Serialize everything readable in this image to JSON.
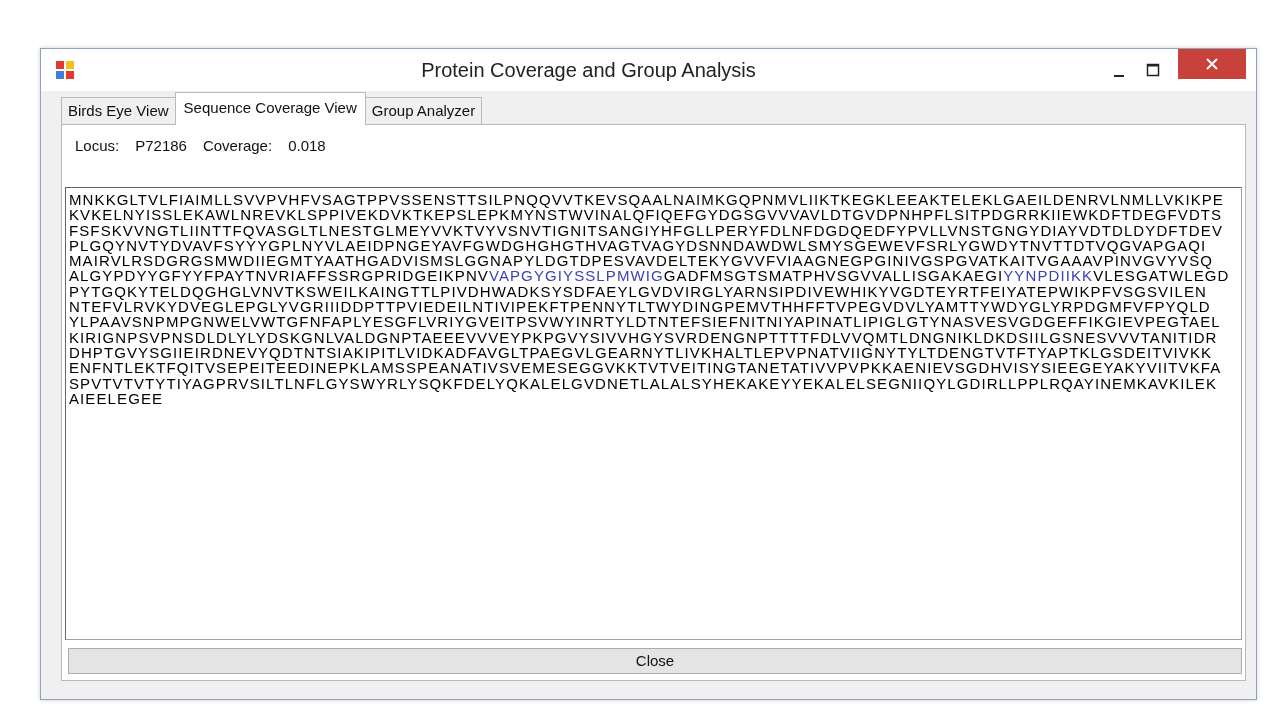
{
  "window": {
    "title": "Protein Coverage and Group Analysis"
  },
  "tabs": [
    {
      "label": "Birds Eye View",
      "selected": false
    },
    {
      "label": "Sequence Coverage View",
      "selected": true
    },
    {
      "label": "Group Analyzer",
      "selected": false
    }
  ],
  "info": {
    "locus_label": "Locus:",
    "locus": "P72186",
    "coverage_label": "Coverage:",
    "coverage": "0.018"
  },
  "sequence_lines": [
    [
      {
        "text": "MNKKGLTVLFIAIMLLSVVPVHFVSAGTPPVSSENSTTSILPNQQVVTKEVSQAALNAIMKGQPNMVLIIKTKEGKLEEAKTELEKLGAEILDENRVLNMLLVKIKPE",
        "covered": false
      }
    ],
    [
      {
        "text": "KVKELNYISSLEKAWLNREVKLSPPIVEKDVKTKEPSLEPKMYNSTWVINALQFIQEFGYDGSGVVVAVLDTGVDPNHPFLSITPDGRRKIIEWKDFTDEGFVDTS",
        "covered": false
      }
    ],
    [
      {
        "text": "FSFSKVVNGTLIINTTFQVASGLTLNESTGLMEYVVKTVYVSNVTIGNITSANGIYHFGLLPERYFDLNFDGDQEDFYPVLLVNSTGNGYDIAYVDTDLDYDFTDEV",
        "covered": false
      }
    ],
    [
      {
        "text": "PLGQYNVTYDVAVFSYYYGPLNYVLAEIDPNGEYAVFGWDGHGHGTHVAGTVAGYDSNNDAWDWLSMYSGEWEVFSRLYGWDYTNVTTDTVQGVAPGAQI",
        "covered": false
      }
    ],
    [
      {
        "text": "MAIRVLRSDGRGSMWDIIEGMTYAATHGADVISMSLGGNAPYLDGTDPESVAVDELTEKYGVVFVIAAGNEGPGINIVGSPGVATKAITVGAAAVPINVGVYVSQ",
        "covered": false
      }
    ],
    [
      {
        "text": "ALGYPDYYGFYYFPAYTNVRIAFFSSRGPRIDGEIKPNV",
        "covered": false
      },
      {
        "text": "VAPGYGIYSSLPMWIG",
        "covered": true
      },
      {
        "text": "GADFMSGTSMATPHVSGVVALLISGAKAEGI",
        "covered": false
      },
      {
        "text": "YYNPDIIKK",
        "covered": true
      },
      {
        "text": "VLESGATWLEGD",
        "covered": false
      }
    ],
    [
      {
        "text": "PYTGQKYTELDQGHGLVNVTKSWEILKAINGTTLPIVDHWADKSYSDFAEYLGVDVIRGLYARNSIPDIVEWHIKYVGDTEYRTFEIYATEPWIKPFVSGSVILEN",
        "covered": false
      }
    ],
    [
      {
        "text": "NTEFVLRVKYDVEGLEPGLYVGRIIIDDPTTPVIEDEILNTIVIPEKFTPENNYTLTWYDINGPEMVTHHFFTVPEGVDVLYAMTTYWDYGLYRPDGMFVFPYQLD",
        "covered": false
      }
    ],
    [
      {
        "text": "YLPAAVSNPMPGNWELVWTGFNFAPLYESGFLVRIYGVEITPSVWYINRTYLDTNTEFSIEFNITNIYAPINATLIPIGLGTYNASVESVGDGEFFIKGIEVPEGTAEL",
        "covered": false
      }
    ],
    [
      {
        "text": "KIRIGNPSVPNSDLDLYLYDSKGNLVALDGNPTAEEEVVVEYPKPGVYSIVVHGYSVRDENGNPTTTTFDLVVQMTLDNGNIKLDKDSIILGSNESVVVTANITIDR",
        "covered": false
      }
    ],
    [
      {
        "text": "DHPTGVYSGIIEIRDNEVYQDTNTSIAKIPITLVIDKADFAVGLTPAEGVLGEARNYTLIVKHALTLEPVPNATVIIGNYTYLTDENGTVTFTYAPTKLGSDEITVIVKK",
        "covered": false
      }
    ],
    [
      {
        "text": "ENFNTLEKTFQITVSEPEITEEDINEPKLAMSSPEANATIVSVEMESEGGVKKTVTVEITINGTANETATIVVPVPKKAENIEVSGDHVISYSIEEGEYAKYVIITVKFA",
        "covered": false
      }
    ],
    [
      {
        "text": "SPVTVTVTYTIYAGPRVSILTLNFLGYSWYRLYSQKFDELYQKALELGVDNETLALALSYHEKAKEYYEKALELSEGNIIQYLGDIRLLPPLRQAYINEMKAVKILEK",
        "covered": false
      }
    ],
    [
      {
        "text": "AIEELEGEE",
        "covered": false
      }
    ]
  ],
  "buttons": {
    "close": "Close"
  }
}
